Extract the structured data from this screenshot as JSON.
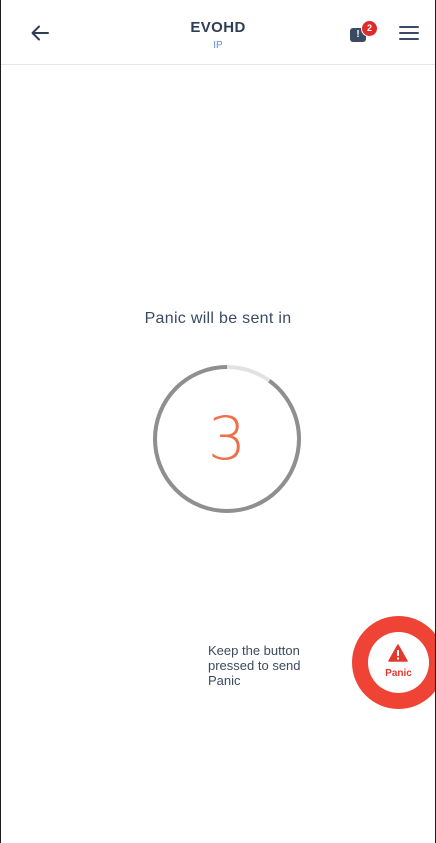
{
  "header": {
    "title": "EVOHD",
    "subtitle": "IP",
    "back_icon": "arrow-left-icon",
    "notification_icon": "alert-message-icon",
    "notification_symbol": "!",
    "notification_count": "2",
    "menu_icon": "hamburger-menu-icon"
  },
  "countdown": {
    "label": "Panic will be sent in",
    "value": "3",
    "progress_remaining_fraction": 0.9,
    "ring_color": "#8f8f8f",
    "ring_track_color": "#e2e2e2",
    "number_color": "#ef7048"
  },
  "panic": {
    "hint": "Keep the button pressed to send Panic",
    "button_label": "Panic",
    "icon": "warning-triangle-icon",
    "color": "#ef4335"
  }
}
